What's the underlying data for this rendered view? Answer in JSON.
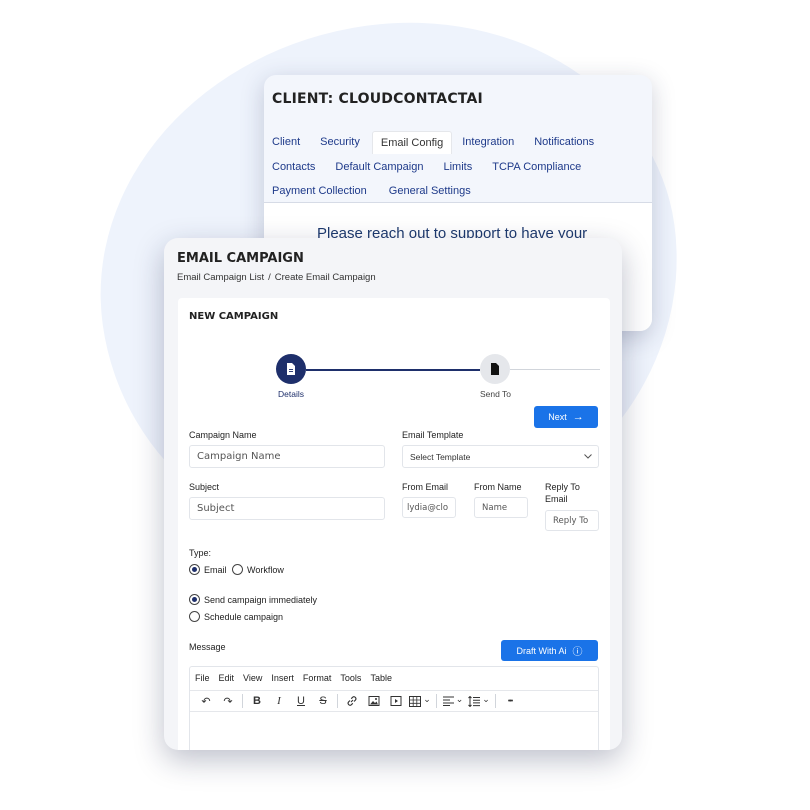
{
  "client_panel": {
    "title": "CLIENT: CLOUDCONTACTAI",
    "tabs_row1": [
      "Client",
      "Security",
      "Email Config",
      "Integration",
      "Notifications"
    ],
    "tabs_row2": [
      "Contacts",
      "Default Campaign",
      "Limits",
      "TCPA Compliance"
    ],
    "tabs_row3": [
      "Payment Collection",
      "General Settings"
    ],
    "active_tab": "Email Config",
    "message": "Please reach out to support to have your"
  },
  "campaign": {
    "title": "EMAIL CAMPAIGN",
    "breadcrumb": [
      "Email Campaign List",
      "/",
      "Create Email Campaign"
    ],
    "section_title": "NEW CAMPAIGN",
    "steps": [
      "Details",
      "Send To"
    ],
    "next_label": "Next",
    "fields": {
      "campaign_name_label": "Campaign Name",
      "campaign_name_placeholder": "Campaign Name",
      "email_template_label": "Email Template",
      "email_template_value": "Select Template",
      "subject_label": "Subject",
      "subject_placeholder": "Subject",
      "from_email_label": "From Email",
      "from_email_value": "lydia@clo",
      "from_name_label": "From Name",
      "from_name_placeholder": "Name",
      "reply_to_label_1": "Reply To",
      "reply_to_label_2": "Email",
      "reply_to_placeholder": "Reply To"
    },
    "type_label": "Type:",
    "type_options": [
      "Email",
      "Workflow"
    ],
    "schedule_options": [
      "Send campaign immediately",
      "Schedule campaign"
    ],
    "message_label": "Message",
    "draft_ai_label": "Draft With Ai",
    "editor_menu": [
      "File",
      "Edit",
      "View",
      "Insert",
      "Format",
      "Tools",
      "Table"
    ]
  },
  "icons": {
    "undo": "↶",
    "redo": "↷",
    "bold": "B",
    "italic": "I",
    "underline": "U",
    "strike": "S",
    "more": "•••",
    "arrow": "→",
    "info": "ⓘ",
    "chevron": "⌄"
  },
  "colors": {
    "primary": "#1a73e8",
    "navy": "#1e2f6b"
  }
}
